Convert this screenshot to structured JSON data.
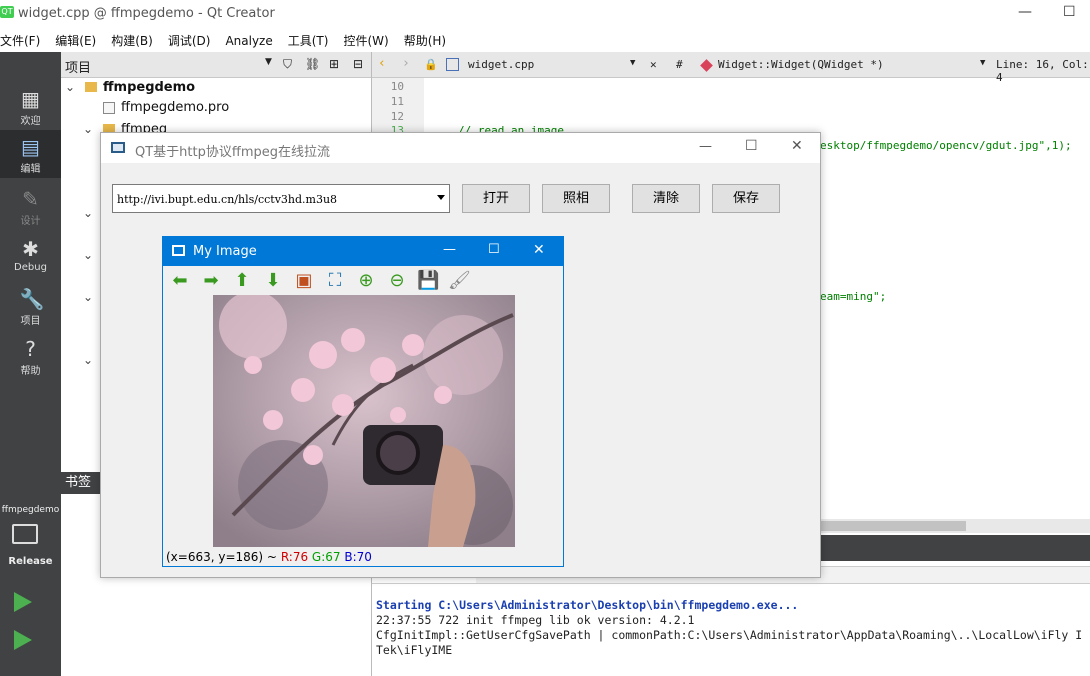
{
  "window": {
    "title": "widget.cpp @ ffmpegdemo - Qt Creator",
    "logo": "QT"
  },
  "menu": [
    "文件(F)",
    "编辑(E)",
    "构建(B)",
    "调试(D)",
    "Analyze",
    "工具(T)",
    "控件(W)",
    "帮助(H)"
  ],
  "modes": [
    {
      "label": "欢迎",
      "icon": "grid-icon"
    },
    {
      "label": "编辑",
      "icon": "edit-doc-icon"
    },
    {
      "label": "设计",
      "icon": "pen-icon"
    },
    {
      "label": "Debug",
      "icon": "bug-icon"
    },
    {
      "label": "项目",
      "icon": "wrench-icon"
    },
    {
      "label": "帮助",
      "icon": "help-icon"
    }
  ],
  "kit": {
    "project": "ffmpegdemo",
    "build": "Release"
  },
  "project_panel": {
    "title": "项目",
    "items": [
      "ffmpegdemo",
      "ffmpegdemo.pro",
      "ffmpeg"
    ]
  },
  "bookmarks": {
    "title": "书签"
  },
  "editor": {
    "file": "widget.cpp",
    "symbol": "Widget::Widget(QWidget *)",
    "hash": "#",
    "position": "Line: 16, Col: 4",
    "line_numbers": [
      "10",
      "11",
      "12",
      "13"
    ],
    "code_comment": "// read an image",
    "code_path": "esktop/ffmpegdemo/opencv/gdut.jpg\",1);",
    "code_stream": "eam=ming\";"
  },
  "output": {
    "lines": [
      "Starting C:\\Users\\Administrator\\Desktop\\bin\\ffmpegdemo.exe...",
      "22:37:55 722 init ffmpeg lib ok  version: 4.2.1",
      "CfgInitImpl::GetUserCfgSavePath | commonPath:C:\\Users\\Administrator\\AppData\\Roaming\\..\\LocalLow\\iFly I",
      "Tek\\iFlyIME"
    ]
  },
  "dialog": {
    "title": "QT基于http协议ffmpeg在线拉流",
    "url": "http://ivi.bupt.edu.cn/hls/cctv3hd.m3u8",
    "buttons": [
      "打开",
      "照相",
      "清除",
      "保存"
    ]
  },
  "image_window": {
    "title": "My Image",
    "status_coord": "(x=663, y=186) ~",
    "r": "R:76",
    "g": "G:67",
    "b": "B:70"
  }
}
